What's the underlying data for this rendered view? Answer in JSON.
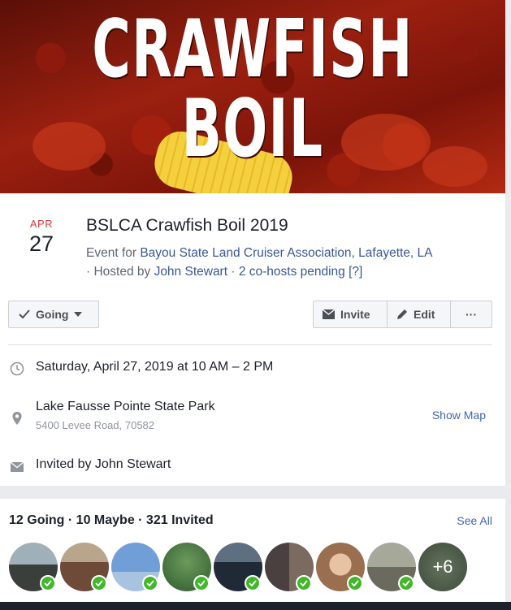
{
  "cover": {
    "title": "CRAWFISH BOIL"
  },
  "event": {
    "month": "APR",
    "day": "27",
    "title": "BSLCA Crawfish Boil 2019",
    "event_for_prefix": "Event for ",
    "event_for_link": "Bayou State Land Cruiser Association, Lafayette, LA",
    "hosted_prefix": " · Hosted by ",
    "host_link": "John Stewart",
    "separator": " · ",
    "cohosts_link": "2 co-hosts pending [?]"
  },
  "actions": {
    "going_label": "Going",
    "invite_label": "Invite",
    "edit_label": "Edit",
    "more_label": "···"
  },
  "details": {
    "datetime": "Saturday, April 27, 2019 at 10 AM – 2 PM",
    "location_name": "Lake Fausse Pointe State Park",
    "location_address": "5400 Levee Road, 70582",
    "show_map": "Show Map",
    "invited_by": "Invited by John Stewart"
  },
  "guests": {
    "summary": "12 Going · 10 Maybe · 321 Invited",
    "see_all": "See All",
    "more_count": "+6",
    "avatar_colors": [
      "#7d8a8f",
      "#8a6e5a",
      "#8fb3d9",
      "#4d7a4a",
      "#3c4a5c",
      "#5a5050",
      "#c9a88a",
      "#8d8d82",
      "#6e8c6a"
    ]
  },
  "colors": {
    "accent": "#4267b2",
    "date_red": "#e0393e",
    "going_green": "#42b72a"
  }
}
